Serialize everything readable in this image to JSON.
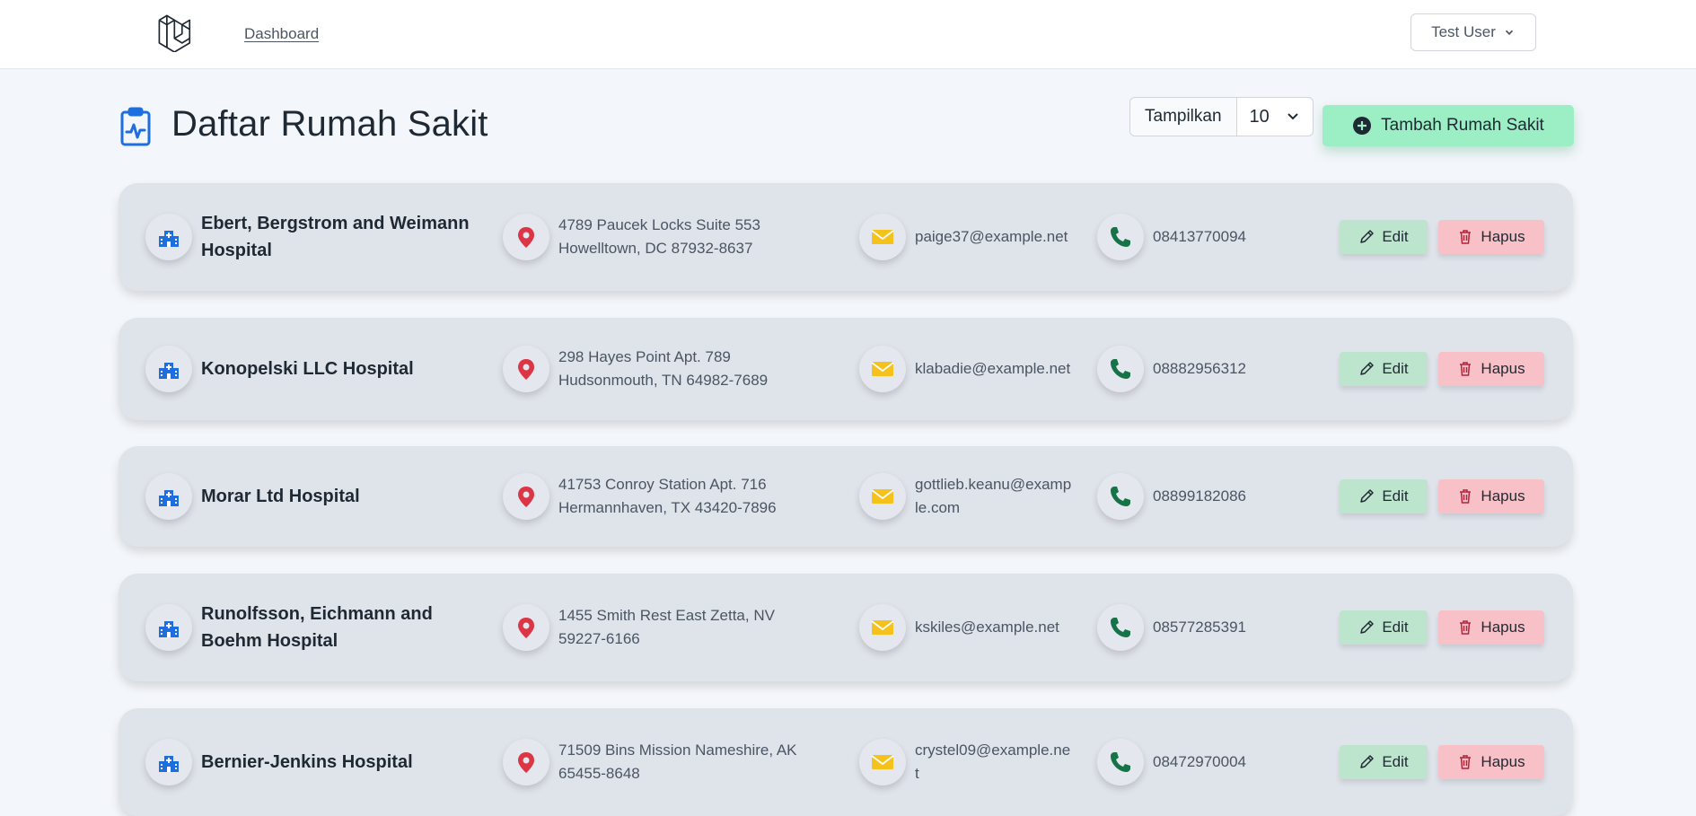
{
  "nav": {
    "dashboard_label": "Dashboard",
    "user_name": "Test User"
  },
  "page": {
    "title": "Daftar Rumah Sakit",
    "show_label": "Tampilkan",
    "show_value": "10",
    "add_label": "Tambah Rumah Sakit"
  },
  "actions": {
    "edit_label": "Edit",
    "delete_label": "Hapus"
  },
  "colors": {
    "add_button": "#9ceec4",
    "edit_button": "#bde5ce",
    "delete_button": "#f8c1c7",
    "hospital_icon": "#1d6fe0",
    "location_icon": "#dc3545",
    "email_icon": "#f5c21b",
    "phone_icon": "#157347"
  },
  "icons": {
    "logo": "laravel-logo-icon",
    "title": "clipboard-pulse-icon",
    "hospital": "hospital-icon",
    "location": "map-pin-icon",
    "email": "envelope-icon",
    "phone": "phone-icon",
    "edit": "pencil-icon",
    "delete": "trash-icon",
    "add": "plus-circle-icon",
    "dropdown": "chevron-down-icon"
  },
  "hospitals": [
    {
      "name": "Ebert, Bergstrom and Weimann Hospital",
      "address": "4789 Paucek Locks Suite 553 Howelltown, DC 87932-8637",
      "email": "paige37@example.net",
      "phone": "08413770094"
    },
    {
      "name": "Konopelski LLC Hospital",
      "address": "298 Hayes Point Apt. 789 Hudsonmouth, TN 64982-7689",
      "email": "klabadie@example.net",
      "phone": "08882956312"
    },
    {
      "name": "Morar Ltd Hospital",
      "address": "41753 Conroy Station Apt. 716 Hermannhaven, TX 43420-7896",
      "email": "gottlieb.keanu@example.com",
      "phone": "08899182086"
    },
    {
      "name": "Runolfsson, Eichmann and Boehm Hospital",
      "address": "1455 Smith Rest East Zetta, NV 59227-6166",
      "email": "kskiles@example.net",
      "phone": "08577285391"
    },
    {
      "name": "Bernier-Jenkins Hospital",
      "address": "71509 Bins Mission Nameshire, AK 65455-8648",
      "email": "crystel09@example.net",
      "phone": "08472970004"
    }
  ]
}
